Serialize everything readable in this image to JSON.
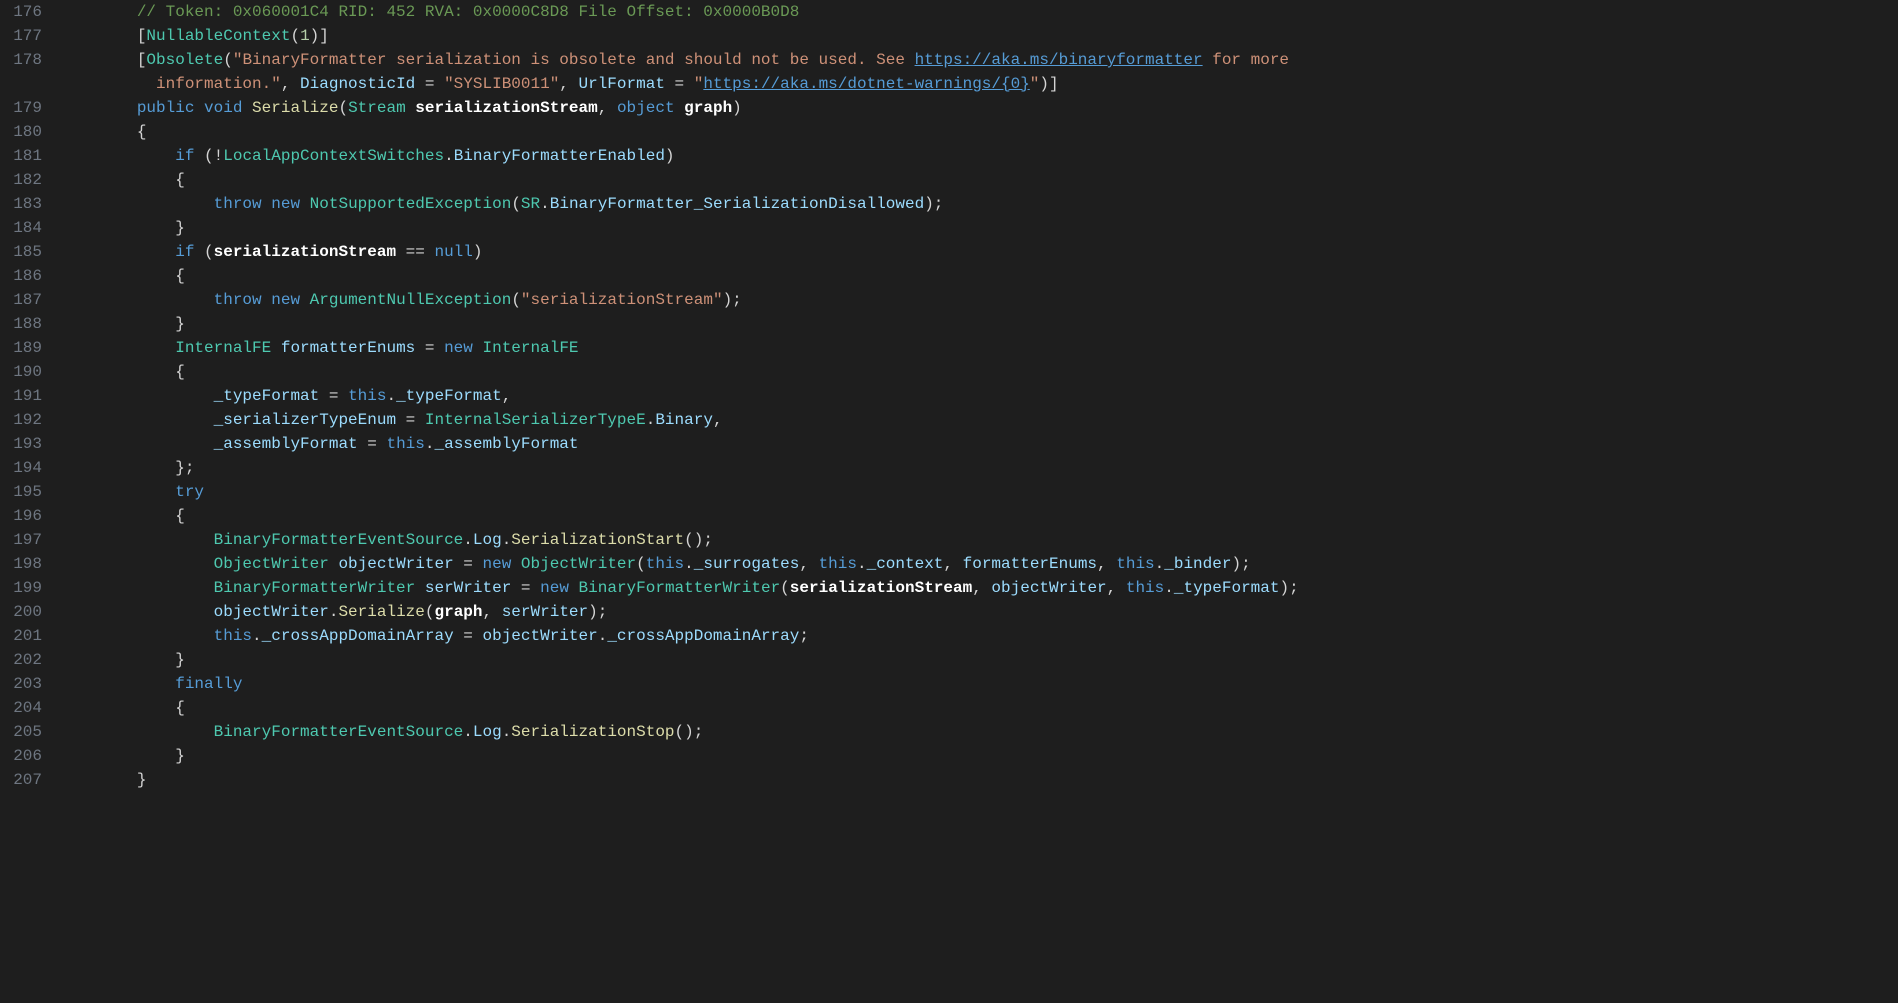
{
  "startLine": 176,
  "lines": [
    {
      "n": 176,
      "segs": [
        {
          "t": "        ",
          "c": "punc"
        },
        {
          "t": "// Token: 0x060001C4 RID: 452 RVA: 0x0000C8D8 File Offset: 0x0000B0D8",
          "c": "cmt"
        }
      ]
    },
    {
      "n": 177,
      "segs": [
        {
          "t": "        ",
          "c": "punc"
        },
        {
          "t": "[",
          "c": "punc"
        },
        {
          "t": "NullableContext",
          "c": "type"
        },
        {
          "t": "(",
          "c": "punc"
        },
        {
          "t": "1",
          "c": "num"
        },
        {
          "t": ")]",
          "c": "punc"
        }
      ]
    },
    {
      "n": 178,
      "segs": [
        {
          "t": "        ",
          "c": "punc"
        },
        {
          "t": "[",
          "c": "punc"
        },
        {
          "t": "Obsolete",
          "c": "type"
        },
        {
          "t": "(",
          "c": "punc"
        },
        {
          "t": "\"BinaryFormatter serialization is obsolete and should not be used. See ",
          "c": "str"
        },
        {
          "t": "https://aka.ms/binaryformatter",
          "c": "url"
        },
        {
          "t": " for more ",
          "c": "str"
        }
      ]
    },
    {
      "n": "178b",
      "cont": true,
      "segs": [
        {
          "t": "          ",
          "c": "punc"
        },
        {
          "t": "information.\"",
          "c": "str"
        },
        {
          "t": ", ",
          "c": "punc"
        },
        {
          "t": "DiagnosticId",
          "c": "prop"
        },
        {
          "t": " = ",
          "c": "punc"
        },
        {
          "t": "\"SYSLIB0011\"",
          "c": "str"
        },
        {
          "t": ", ",
          "c": "punc"
        },
        {
          "t": "UrlFormat",
          "c": "prop"
        },
        {
          "t": " = ",
          "c": "punc"
        },
        {
          "t": "\"",
          "c": "str"
        },
        {
          "t": "https://aka.ms/dotnet-warnings/{0}",
          "c": "url"
        },
        {
          "t": "\"",
          "c": "str"
        },
        {
          "t": ")]",
          "c": "punc"
        }
      ]
    },
    {
      "n": 179,
      "segs": [
        {
          "t": "        ",
          "c": "punc"
        },
        {
          "t": "public",
          "c": "kw"
        },
        {
          "t": " ",
          "c": "punc"
        },
        {
          "t": "void",
          "c": "kw"
        },
        {
          "t": " ",
          "c": "punc"
        },
        {
          "t": "Serialize",
          "c": "mth"
        },
        {
          "t": "(",
          "c": "punc"
        },
        {
          "t": "Stream",
          "c": "type"
        },
        {
          "t": " ",
          "c": "punc"
        },
        {
          "t": "serializationStream",
          "c": "white bold"
        },
        {
          "t": ", ",
          "c": "punc"
        },
        {
          "t": "object",
          "c": "kw"
        },
        {
          "t": " ",
          "c": "punc"
        },
        {
          "t": "graph",
          "c": "white bold"
        },
        {
          "t": ")",
          "c": "punc"
        }
      ]
    },
    {
      "n": 180,
      "segs": [
        {
          "t": "        {",
          "c": "punc"
        }
      ]
    },
    {
      "n": 181,
      "segs": [
        {
          "t": "            ",
          "c": "punc"
        },
        {
          "t": "if",
          "c": "kw"
        },
        {
          "t": " (!",
          "c": "punc"
        },
        {
          "t": "LocalAppContextSwitches",
          "c": "type"
        },
        {
          "t": ".",
          "c": "punc"
        },
        {
          "t": "BinaryFormatterEnabled",
          "c": "prop"
        },
        {
          "t": ")",
          "c": "punc"
        }
      ]
    },
    {
      "n": 182,
      "segs": [
        {
          "t": "            {",
          "c": "punc"
        }
      ]
    },
    {
      "n": 183,
      "segs": [
        {
          "t": "                ",
          "c": "punc"
        },
        {
          "t": "throw",
          "c": "kw"
        },
        {
          "t": " ",
          "c": "punc"
        },
        {
          "t": "new",
          "c": "kw"
        },
        {
          "t": " ",
          "c": "punc"
        },
        {
          "t": "NotSupportedException",
          "c": "type"
        },
        {
          "t": "(",
          "c": "punc"
        },
        {
          "t": "SR",
          "c": "type"
        },
        {
          "t": ".",
          "c": "punc"
        },
        {
          "t": "BinaryFormatter_SerializationDisallowed",
          "c": "prop"
        },
        {
          "t": ");",
          "c": "punc"
        }
      ]
    },
    {
      "n": 184,
      "segs": [
        {
          "t": "            }",
          "c": "punc"
        }
      ]
    },
    {
      "n": 185,
      "segs": [
        {
          "t": "            ",
          "c": "punc"
        },
        {
          "t": "if",
          "c": "kw"
        },
        {
          "t": " (",
          "c": "punc"
        },
        {
          "t": "serializationStream",
          "c": "white bold"
        },
        {
          "t": " == ",
          "c": "punc"
        },
        {
          "t": "null",
          "c": "kw"
        },
        {
          "t": ")",
          "c": "punc"
        }
      ]
    },
    {
      "n": 186,
      "segs": [
        {
          "t": "            {",
          "c": "punc"
        }
      ]
    },
    {
      "n": 187,
      "segs": [
        {
          "t": "                ",
          "c": "punc"
        },
        {
          "t": "throw",
          "c": "kw"
        },
        {
          "t": " ",
          "c": "punc"
        },
        {
          "t": "new",
          "c": "kw"
        },
        {
          "t": " ",
          "c": "punc"
        },
        {
          "t": "ArgumentNullException",
          "c": "type"
        },
        {
          "t": "(",
          "c": "punc"
        },
        {
          "t": "\"serializationStream\"",
          "c": "str"
        },
        {
          "t": ");",
          "c": "punc"
        }
      ]
    },
    {
      "n": 188,
      "segs": [
        {
          "t": "            }",
          "c": "punc"
        }
      ]
    },
    {
      "n": 189,
      "segs": [
        {
          "t": "            ",
          "c": "punc"
        },
        {
          "t": "InternalFE",
          "c": "type"
        },
        {
          "t": " ",
          "c": "punc"
        },
        {
          "t": "formatterEnums",
          "c": "var"
        },
        {
          "t": " = ",
          "c": "punc"
        },
        {
          "t": "new",
          "c": "kw"
        },
        {
          "t": " ",
          "c": "punc"
        },
        {
          "t": "InternalFE",
          "c": "type"
        }
      ]
    },
    {
      "n": 190,
      "segs": [
        {
          "t": "            {",
          "c": "punc"
        }
      ]
    },
    {
      "n": 191,
      "segs": [
        {
          "t": "                ",
          "c": "punc"
        },
        {
          "t": "_typeFormat",
          "c": "prop"
        },
        {
          "t": " = ",
          "c": "punc"
        },
        {
          "t": "this",
          "c": "kw"
        },
        {
          "t": ".",
          "c": "punc"
        },
        {
          "t": "_typeFormat",
          "c": "prop"
        },
        {
          "t": ",",
          "c": "punc"
        }
      ]
    },
    {
      "n": 192,
      "segs": [
        {
          "t": "                ",
          "c": "punc"
        },
        {
          "t": "_serializerTypeEnum",
          "c": "prop"
        },
        {
          "t": " = ",
          "c": "punc"
        },
        {
          "t": "InternalSerializerTypeE",
          "c": "type"
        },
        {
          "t": ".",
          "c": "punc"
        },
        {
          "t": "Binary",
          "c": "prop"
        },
        {
          "t": ",",
          "c": "punc"
        }
      ]
    },
    {
      "n": 193,
      "segs": [
        {
          "t": "                ",
          "c": "punc"
        },
        {
          "t": "_assemblyFormat",
          "c": "prop"
        },
        {
          "t": " = ",
          "c": "punc"
        },
        {
          "t": "this",
          "c": "kw"
        },
        {
          "t": ".",
          "c": "punc"
        },
        {
          "t": "_assemblyFormat",
          "c": "prop"
        }
      ]
    },
    {
      "n": 194,
      "segs": [
        {
          "t": "            };",
          "c": "punc"
        }
      ]
    },
    {
      "n": 195,
      "segs": [
        {
          "t": "            ",
          "c": "punc"
        },
        {
          "t": "try",
          "c": "kw"
        }
      ]
    },
    {
      "n": 196,
      "segs": [
        {
          "t": "            {",
          "c": "punc"
        }
      ]
    },
    {
      "n": 197,
      "segs": [
        {
          "t": "                ",
          "c": "punc"
        },
        {
          "t": "BinaryFormatterEventSource",
          "c": "type"
        },
        {
          "t": ".",
          "c": "punc"
        },
        {
          "t": "Log",
          "c": "prop"
        },
        {
          "t": ".",
          "c": "punc"
        },
        {
          "t": "SerializationStart",
          "c": "mth"
        },
        {
          "t": "();",
          "c": "punc"
        }
      ]
    },
    {
      "n": 198,
      "segs": [
        {
          "t": "                ",
          "c": "punc"
        },
        {
          "t": "ObjectWriter",
          "c": "type"
        },
        {
          "t": " ",
          "c": "punc"
        },
        {
          "t": "objectWriter",
          "c": "var"
        },
        {
          "t": " = ",
          "c": "punc"
        },
        {
          "t": "new",
          "c": "kw"
        },
        {
          "t": " ",
          "c": "punc"
        },
        {
          "t": "ObjectWriter",
          "c": "type"
        },
        {
          "t": "(",
          "c": "punc"
        },
        {
          "t": "this",
          "c": "kw"
        },
        {
          "t": ".",
          "c": "punc"
        },
        {
          "t": "_surrogates",
          "c": "prop"
        },
        {
          "t": ", ",
          "c": "punc"
        },
        {
          "t": "this",
          "c": "kw"
        },
        {
          "t": ".",
          "c": "punc"
        },
        {
          "t": "_context",
          "c": "prop"
        },
        {
          "t": ", ",
          "c": "punc"
        },
        {
          "t": "formatterEnums",
          "c": "var"
        },
        {
          "t": ", ",
          "c": "punc"
        },
        {
          "t": "this",
          "c": "kw"
        },
        {
          "t": ".",
          "c": "punc"
        },
        {
          "t": "_binder",
          "c": "prop"
        },
        {
          "t": ");",
          "c": "punc"
        }
      ]
    },
    {
      "n": 199,
      "segs": [
        {
          "t": "                ",
          "c": "punc"
        },
        {
          "t": "BinaryFormatterWriter",
          "c": "type"
        },
        {
          "t": " ",
          "c": "punc"
        },
        {
          "t": "serWriter",
          "c": "var"
        },
        {
          "t": " = ",
          "c": "punc"
        },
        {
          "t": "new",
          "c": "kw"
        },
        {
          "t": " ",
          "c": "punc"
        },
        {
          "t": "BinaryFormatterWriter",
          "c": "type"
        },
        {
          "t": "(",
          "c": "punc"
        },
        {
          "t": "serializationStream",
          "c": "white bold"
        },
        {
          "t": ", ",
          "c": "punc"
        },
        {
          "t": "objectWriter",
          "c": "var"
        },
        {
          "t": ", ",
          "c": "punc"
        },
        {
          "t": "this",
          "c": "kw"
        },
        {
          "t": ".",
          "c": "punc"
        },
        {
          "t": "_typeFormat",
          "c": "prop"
        },
        {
          "t": ");",
          "c": "punc"
        }
      ]
    },
    {
      "n": 200,
      "segs": [
        {
          "t": "                ",
          "c": "punc"
        },
        {
          "t": "objectWriter",
          "c": "var"
        },
        {
          "t": ".",
          "c": "punc"
        },
        {
          "t": "Serialize",
          "c": "mth"
        },
        {
          "t": "(",
          "c": "punc"
        },
        {
          "t": "graph",
          "c": "white bold"
        },
        {
          "t": ", ",
          "c": "punc"
        },
        {
          "t": "serWriter",
          "c": "var"
        },
        {
          "t": ");",
          "c": "punc"
        }
      ]
    },
    {
      "n": 201,
      "segs": [
        {
          "t": "                ",
          "c": "punc"
        },
        {
          "t": "this",
          "c": "kw"
        },
        {
          "t": ".",
          "c": "punc"
        },
        {
          "t": "_crossAppDomainArray",
          "c": "prop"
        },
        {
          "t": " = ",
          "c": "punc"
        },
        {
          "t": "objectWriter",
          "c": "var"
        },
        {
          "t": ".",
          "c": "punc"
        },
        {
          "t": "_crossAppDomainArray",
          "c": "prop"
        },
        {
          "t": ";",
          "c": "punc"
        }
      ]
    },
    {
      "n": 202,
      "segs": [
        {
          "t": "            }",
          "c": "punc"
        }
      ]
    },
    {
      "n": 203,
      "segs": [
        {
          "t": "            ",
          "c": "punc"
        },
        {
          "t": "finally",
          "c": "kw"
        }
      ]
    },
    {
      "n": 204,
      "segs": [
        {
          "t": "            {",
          "c": "punc"
        }
      ]
    },
    {
      "n": 205,
      "segs": [
        {
          "t": "                ",
          "c": "punc"
        },
        {
          "t": "BinaryFormatterEventSource",
          "c": "type"
        },
        {
          "t": ".",
          "c": "punc"
        },
        {
          "t": "Log",
          "c": "prop"
        },
        {
          "t": ".",
          "c": "punc"
        },
        {
          "t": "SerializationStop",
          "c": "mth"
        },
        {
          "t": "();",
          "c": "punc"
        }
      ]
    },
    {
      "n": 206,
      "segs": [
        {
          "t": "            }",
          "c": "punc"
        }
      ]
    },
    {
      "n": 207,
      "segs": [
        {
          "t": "        }",
          "c": "punc"
        }
      ]
    }
  ]
}
